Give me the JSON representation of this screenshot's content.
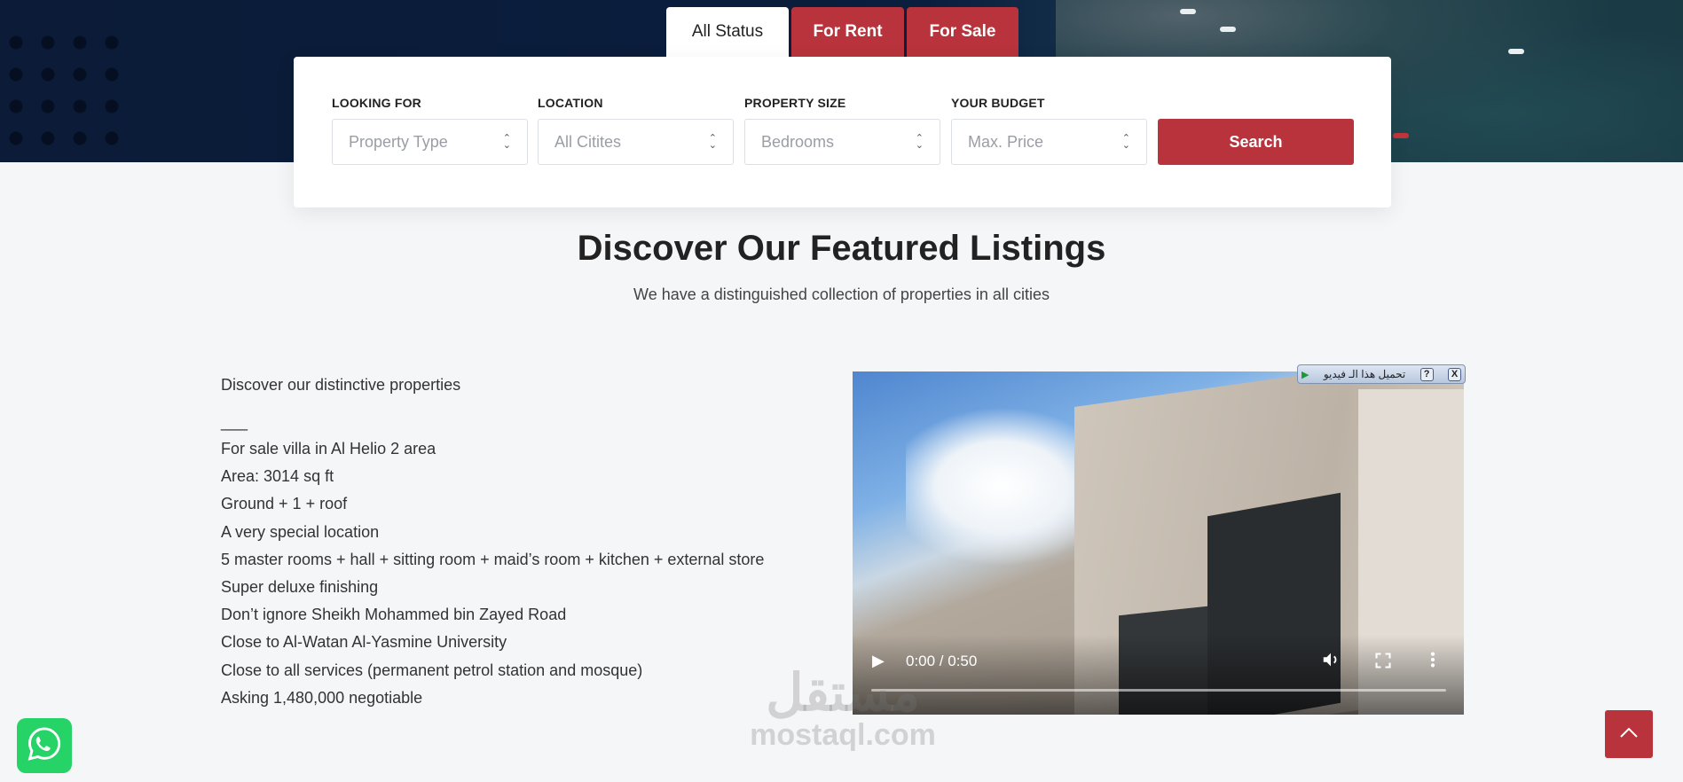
{
  "tabs": [
    {
      "label": "All Status"
    },
    {
      "label": "For Rent"
    },
    {
      "label": "For Sale"
    }
  ],
  "search": {
    "looking_for": {
      "label": "LOOKING FOR",
      "value": "Property Type"
    },
    "location": {
      "label": "LOCATION",
      "value": "All Citites"
    },
    "size": {
      "label": "PROPERTY SIZE",
      "value": "Bedrooms"
    },
    "budget": {
      "label": "YOUR BUDGET",
      "value": "Max. Price"
    },
    "button": "Search"
  },
  "section": {
    "title": "Discover Our Featured Listings",
    "subtitle": "We have a distinguished collection of properties in all cities"
  },
  "listing": {
    "intro": "Discover our distinctive properties",
    "separator": "___",
    "lines": [
      "For sale villa in Al Helio 2 area",
      "Area: 3014 sq ft",
      "Ground + 1 + roof",
      "A very special location",
      "5 master rooms + hall + sitting room + maid’s room + kitchen + external store",
      "Super deluxe finishing",
      "Don’t ignore Sheikh Mohammed bin Zayed Road",
      "Close to Al-Watan Al-Yasmine University",
      "Close to all services (permanent petrol station and mosque)",
      "Asking 1,480,000 negotiable"
    ]
  },
  "video": {
    "time": "0:00 / 0:50",
    "download_bar": "تحميل هذا الـ فيديو",
    "help": "?",
    "close": "X"
  },
  "watermark": {
    "arabic": "مستقل",
    "latin": "mostaql.com"
  },
  "icons": {
    "whatsapp": "whatsapp-icon",
    "back_to_top": "chevron-up-icon",
    "play": "play-icon",
    "volume": "volume-icon",
    "fullscreen": "fullscreen-icon",
    "more": "more-vertical-icon"
  },
  "colors": {
    "accent": "#b8333b",
    "hero": "#0b1b38",
    "whatsapp": "#25d366"
  }
}
